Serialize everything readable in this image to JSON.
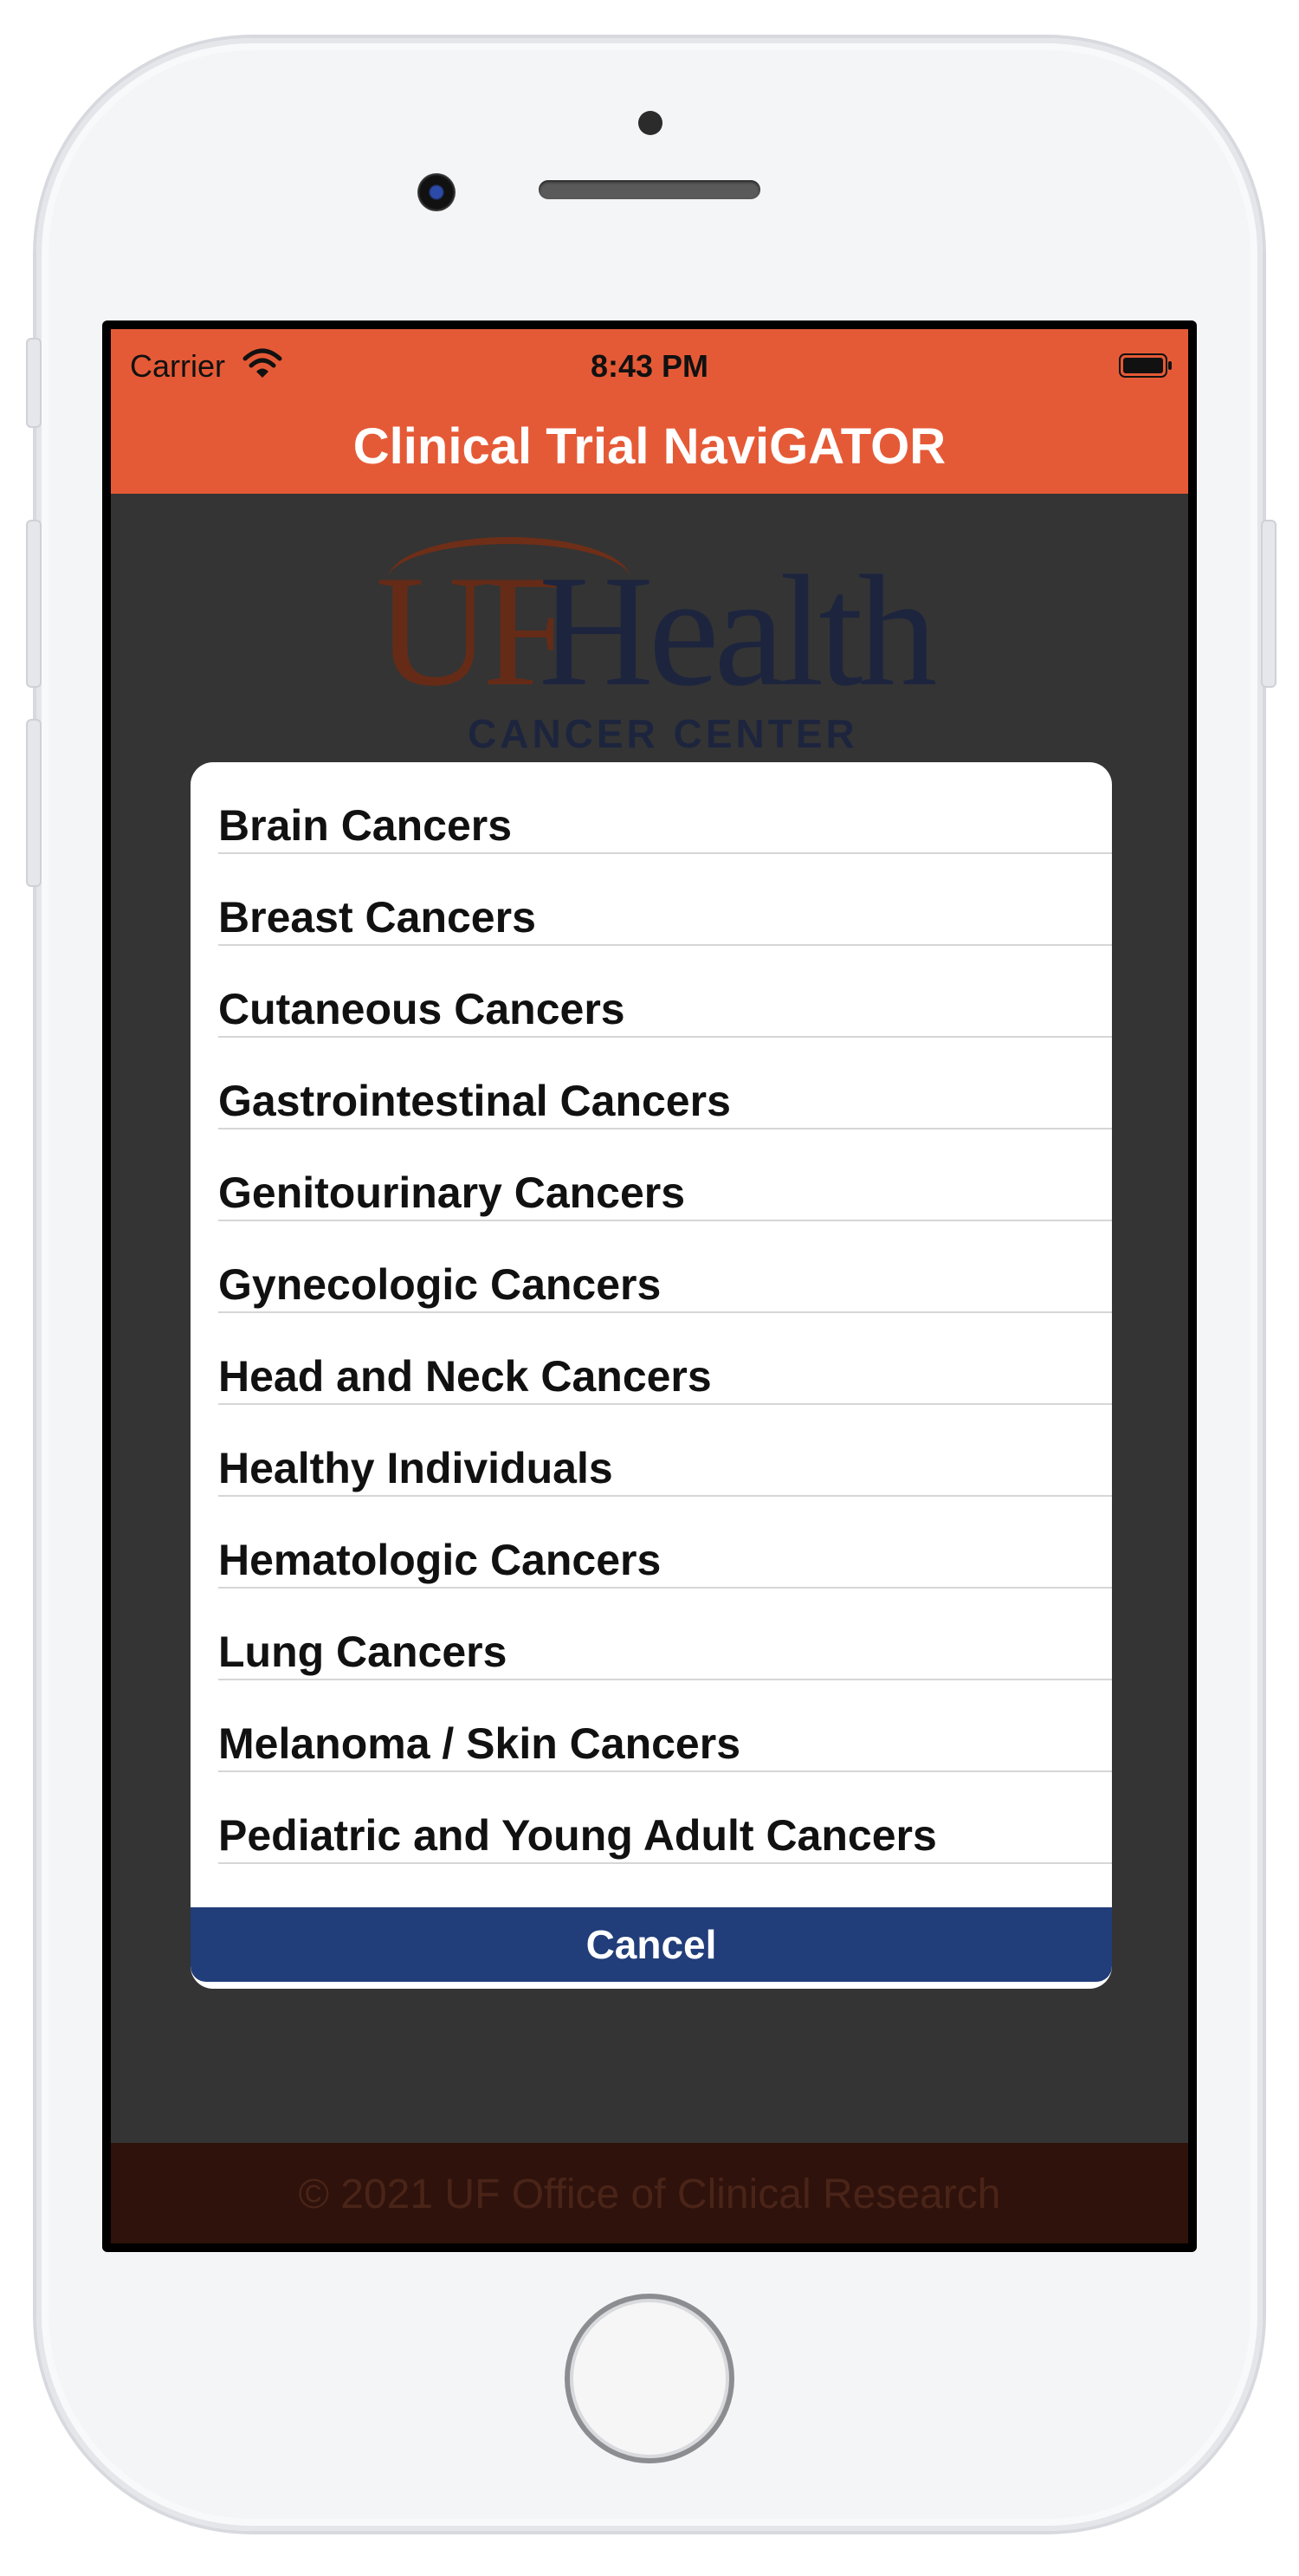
{
  "status_bar": {
    "carrier": "Carrier",
    "time": "8:43 PM"
  },
  "nav": {
    "title": "Clinical Trial NaviGATOR"
  },
  "logo": {
    "uf": "UF",
    "health": "Health",
    "subtitle": "CANCER CENTER"
  },
  "footer": {
    "copyright": "© 2021 UF Office of Clinical Research"
  },
  "sheet": {
    "items": [
      "Brain Cancers",
      "Breast Cancers",
      "Cutaneous Cancers",
      "Gastrointestinal Cancers",
      "Genitourinary Cancers",
      "Gynecologic Cancers",
      "Head and Neck Cancers",
      "Healthy Individuals",
      "Hematologic Cancers",
      "Lung Cancers",
      "Melanoma / Skin Cancers",
      "Pediatric and Young Adult Cancers"
    ],
    "cancel_label": "Cancel"
  },
  "colors": {
    "brand_orange": "#e55a36",
    "cancel_blue": "#213d7a"
  }
}
